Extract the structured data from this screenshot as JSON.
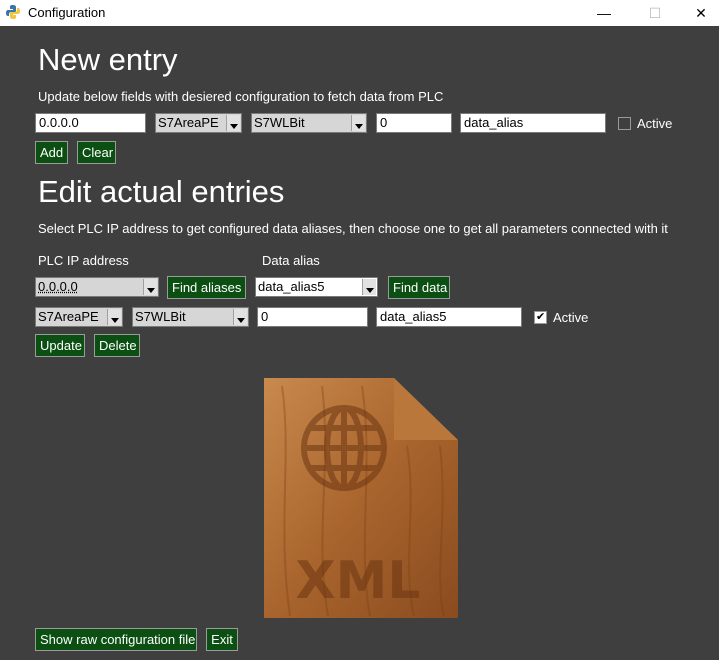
{
  "window": {
    "title": "Configuration",
    "minimize": "—",
    "maximize": "☐",
    "close": "✕"
  },
  "new_entry": {
    "heading": "New entry",
    "description": "Update below fields with desiered configuration to fetch data from PLC",
    "ip_value": "0.0.0.0",
    "area_value": "S7AreaPE",
    "wordlen_value": "S7WLBit",
    "offset_value": "0",
    "alias_value": "data_alias",
    "active_label": "Active",
    "active_checked": false,
    "add_label": "Add",
    "clear_label": "Clear"
  },
  "edit": {
    "heading": "Edit actual entries",
    "description": "Select PLC IP address to get configured data aliases, then choose one to get all parameters connected with it",
    "ip_label": "PLC IP address",
    "alias_label": "Data alias",
    "ip_value": "0.0.0.0",
    "find_aliases_label": "Find aliases",
    "alias_value": "data_alias5",
    "find_data_label": "Find data",
    "area_value": "S7AreaPE",
    "wordlen_value": "S7WLBit",
    "offset_value": "0",
    "alias_entry_value": "data_alias5",
    "active_label": "Active",
    "active_checked": true,
    "update_label": "Update",
    "delete_label": "Delete"
  },
  "xml_image": {
    "icon": "xml-file-icon",
    "text": "XML"
  },
  "bottom": {
    "show_raw_label": "Show raw configuration file",
    "exit_label": "Exit"
  }
}
